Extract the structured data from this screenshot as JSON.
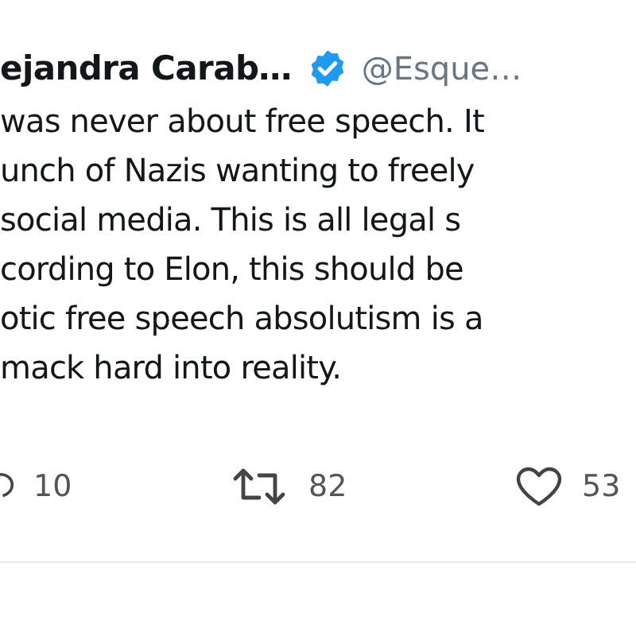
{
  "tweet": {
    "author_name": "ejandra Carab…",
    "verified": true,
    "handle": "@Esque…",
    "lines": [
      "was never about free speech. It",
      "unch of Nazis wanting to freely",
      "social media. This is all legal s",
      "cording to Elon, this should be",
      "otic free speech absolutism is a",
      "mack hard into reality."
    ],
    "actions": [
      {
        "kind": "reply",
        "count": "10"
      },
      {
        "kind": "retweet",
        "count": "82"
      },
      {
        "kind": "like",
        "count": "53"
      }
    ]
  }
}
